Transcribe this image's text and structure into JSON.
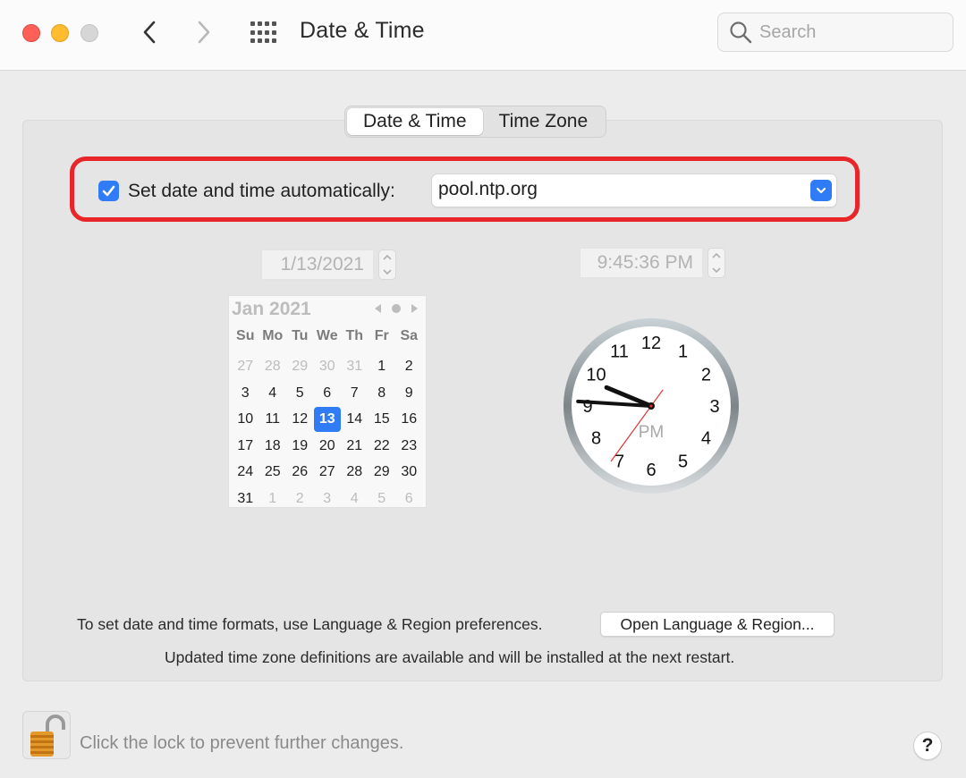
{
  "window": {
    "title": "Date & Time",
    "search_placeholder": "Search"
  },
  "tabs": [
    {
      "label": "Date & Time",
      "active": true
    },
    {
      "label": "Time Zone",
      "active": false
    }
  ],
  "auto": {
    "checked": true,
    "label": "Set date and time automatically:",
    "server": "pool.ntp.org"
  },
  "date_field": "1/13/2021",
  "time_field": "9:45:36 PM",
  "calendar": {
    "month": "Jan 2021",
    "weekdays": [
      "Su",
      "Mo",
      "Tu",
      "We",
      "Th",
      "Fr",
      "Sa"
    ],
    "weeks": [
      [
        "27",
        "28",
        "29",
        "30",
        "31",
        "1",
        "2"
      ],
      [
        "3",
        "4",
        "5",
        "6",
        "7",
        "8",
        "9"
      ],
      [
        "10",
        "11",
        "12",
        "13",
        "14",
        "15",
        "16"
      ],
      [
        "17",
        "18",
        "19",
        "20",
        "21",
        "22",
        "23"
      ],
      [
        "24",
        "25",
        "26",
        "27",
        "28",
        "29",
        "30"
      ],
      [
        "31",
        "1",
        "2",
        "3",
        "4",
        "5",
        "6"
      ]
    ],
    "selected": "13"
  },
  "clock": {
    "period": "PM",
    "hours": 9,
    "minutes": 45,
    "seconds": 36,
    "numerals": [
      "12",
      "1",
      "2",
      "3",
      "4",
      "5",
      "6",
      "7",
      "8",
      "9",
      "10",
      "11"
    ]
  },
  "footer": {
    "formats_text": "To set date and time formats, use Language & Region preferences.",
    "open_button": "Open Language & Region...",
    "tz_note": "Updated time zone definitions are available and will be installed at the next restart.",
    "lock_text": "Click the lock to prevent further changes.",
    "help_label": "?"
  },
  "colors": {
    "accent": "#2f7cf6",
    "highlight": "#e8262a"
  }
}
